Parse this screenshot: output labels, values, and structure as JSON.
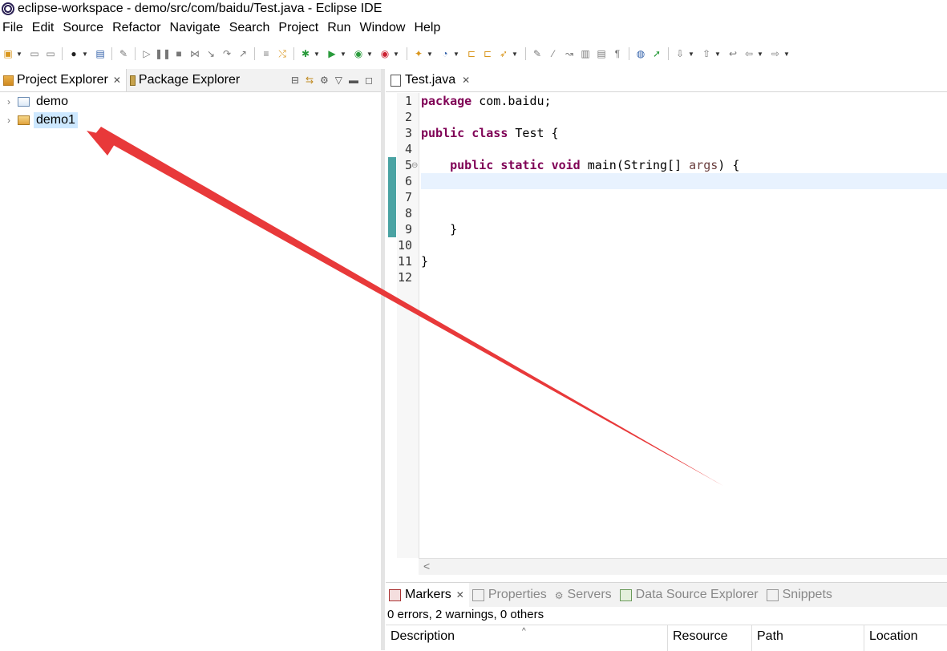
{
  "window": {
    "title": "eclipse-workspace - demo/src/com/baidu/Test.java - Eclipse IDE"
  },
  "menu": [
    "File",
    "Edit",
    "Source",
    "Refactor",
    "Navigate",
    "Search",
    "Project",
    "Run",
    "Window",
    "Help"
  ],
  "left_panel": {
    "tabs": [
      {
        "label": "Project Explorer",
        "active": true
      },
      {
        "label": "Package Explorer",
        "active": false
      }
    ],
    "tree": [
      {
        "label": "demo",
        "selected": false
      },
      {
        "label": "demo1",
        "selected": true
      }
    ]
  },
  "editor": {
    "tab": {
      "label": "Test.java"
    },
    "line_numbers": [
      "1",
      "2",
      "3",
      "4",
      "5",
      "6",
      "7",
      "8",
      "9",
      "10",
      "11",
      "12"
    ],
    "code": {
      "l1_kw": "package",
      "l1_rest": " com.baidu;",
      "l3_kw1": "public",
      "l3_kw2": "class",
      "l3_rest": " Test {",
      "l5_kw1": "public",
      "l5_kw2": "static",
      "l5_kw3": "void",
      "l5_rest": " main(String[] ",
      "l5_param": "args",
      "l5_end": ") {",
      "l9": "    }",
      "l11": "}"
    },
    "scroll_left": "<"
  },
  "bottom_panel": {
    "tabs": [
      {
        "label": "Markers",
        "active": true
      },
      {
        "label": "Properties",
        "active": false
      },
      {
        "label": "Servers",
        "active": false
      },
      {
        "label": "Data Source Explorer",
        "active": false
      },
      {
        "label": "Snippets",
        "active": false
      }
    ],
    "summary": "0 errors, 2 warnings, 0 others",
    "columns": [
      "Description",
      "Resource",
      "Path",
      "Location"
    ]
  },
  "colors": {
    "arrow": "#e8393a",
    "selection": "#cde8ff",
    "keyword": "#7f0055"
  }
}
